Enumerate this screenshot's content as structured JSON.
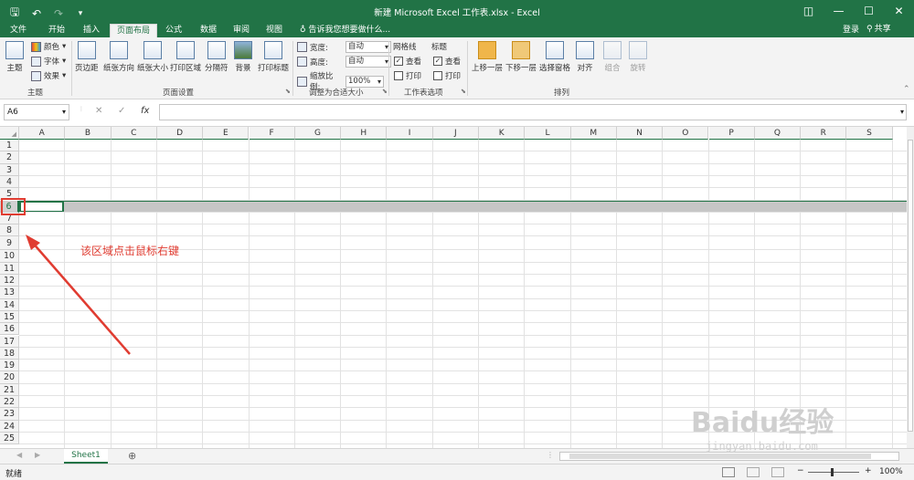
{
  "window": {
    "title": "新建 Microsoft Excel 工作表.xlsx - Excel",
    "controls": [
      "◫",
      "—",
      "☐",
      "✕"
    ]
  },
  "qat": {
    "save_icon": "save-icon",
    "undo_icon": "undo-icon",
    "redo_icon": "redo-icon"
  },
  "tabs": [
    "文件",
    "开始",
    "插入",
    "页面布局",
    "公式",
    "数据",
    "审阅",
    "视图"
  ],
  "active_tab": "页面布局",
  "tell_me": "告诉我您想要做什么...",
  "login": "登录",
  "share": "共享",
  "ribbon": {
    "themes": {
      "theme": "主题",
      "colors": "颜色",
      "fonts": "字体",
      "effects": "效果",
      "group": "主题"
    },
    "page_setup": {
      "buttons": [
        "页边距",
        "纸张方向",
        "纸张大小",
        "打印区域",
        "分隔符",
        "背景",
        "打印标题"
      ],
      "group": "页面设置"
    },
    "scale": {
      "width_label": "宽度:",
      "width_value": "自动",
      "height_label": "高度:",
      "height_value": "自动",
      "scale_label": "缩放比例:",
      "scale_value": "100%",
      "group": "调整为合适大小"
    },
    "sheet_options": {
      "gridlines": "网格线",
      "headings": "标题",
      "view": "查看",
      "print": "打印",
      "gridlines_view_checked": true,
      "gridlines_print_checked": false,
      "headings_view_checked": true,
      "headings_print_checked": false,
      "group": "工作表选项"
    },
    "arrange": {
      "buttons": [
        "上移一层",
        "下移一层",
        "选择窗格",
        "对齐",
        "组合",
        "旋转"
      ],
      "group": "排列"
    }
  },
  "formula_bar": {
    "name_box": "A6",
    "cancel": "✕",
    "enter": "✓",
    "fx": "fx",
    "content": ""
  },
  "columns": [
    "A",
    "B",
    "C",
    "D",
    "E",
    "F",
    "G",
    "H",
    "I",
    "J",
    "K",
    "L",
    "M",
    "N",
    "O",
    "P",
    "Q",
    "R",
    "S"
  ],
  "rows": [
    "1",
    "2",
    "3",
    "4",
    "5",
    "6",
    "7",
    "8",
    "9",
    "10",
    "11",
    "12",
    "13",
    "14",
    "15",
    "16",
    "17",
    "18",
    "19",
    "20",
    "21",
    "22",
    "23",
    "24",
    "25"
  ],
  "selected_row": "6",
  "annotation": "该区域点击鼠标右键",
  "sheet_tabs": [
    "Sheet1"
  ],
  "add_sheet": "⊕",
  "status": {
    "ready": "就绪",
    "zoom": "100%"
  },
  "watermark": {
    "text": "Baidu经验",
    "url": "jingyan.baidu.com"
  }
}
